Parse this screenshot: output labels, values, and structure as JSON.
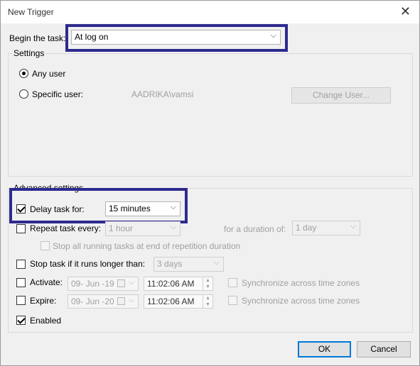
{
  "window": {
    "title": "New Trigger",
    "close_glyph": "✕"
  },
  "begin": {
    "label": "Begin the task:",
    "value": "At log on"
  },
  "settings": {
    "legend": "Settings",
    "any_user_label": "Any user",
    "specific_user_label": "Specific user:",
    "user_value": "AADRIKA\\vamsi",
    "change_user_label": "Change User..."
  },
  "advanced": {
    "legend": "Advanced settings",
    "delay": {
      "label": "Delay task for:",
      "value": "15 minutes",
      "checked": true
    },
    "repeat": {
      "label": "Repeat task every:",
      "value": "1 hour",
      "duration_label": "for a duration of:",
      "duration_value": "1 day"
    },
    "stop_all_label": "Stop all running tasks at end of repetition duration",
    "stop_long": {
      "label": "Stop task if it runs longer than:",
      "value": "3 days"
    },
    "activate": {
      "label": "Activate:",
      "date": "09- Jun -19",
      "time": "11:02:06 AM",
      "sync_label": "Synchronize across time zones"
    },
    "expire": {
      "label": "Expire:",
      "date": "09- Jun -20",
      "time": "11:02:06 AM",
      "sync_label": "Synchronize across time zones"
    },
    "enabled": {
      "label": "Enabled",
      "checked": true
    }
  },
  "buttons": {
    "ok": "OK",
    "cancel": "Cancel"
  },
  "icons": {
    "dropdown": "chevron-down-icon",
    "close": "close-icon",
    "calendar": "calendar-icon",
    "spin": "spin-arrows-icon"
  },
  "colors": {
    "highlight": "#2d2a8e",
    "accent": "#0078d7"
  }
}
